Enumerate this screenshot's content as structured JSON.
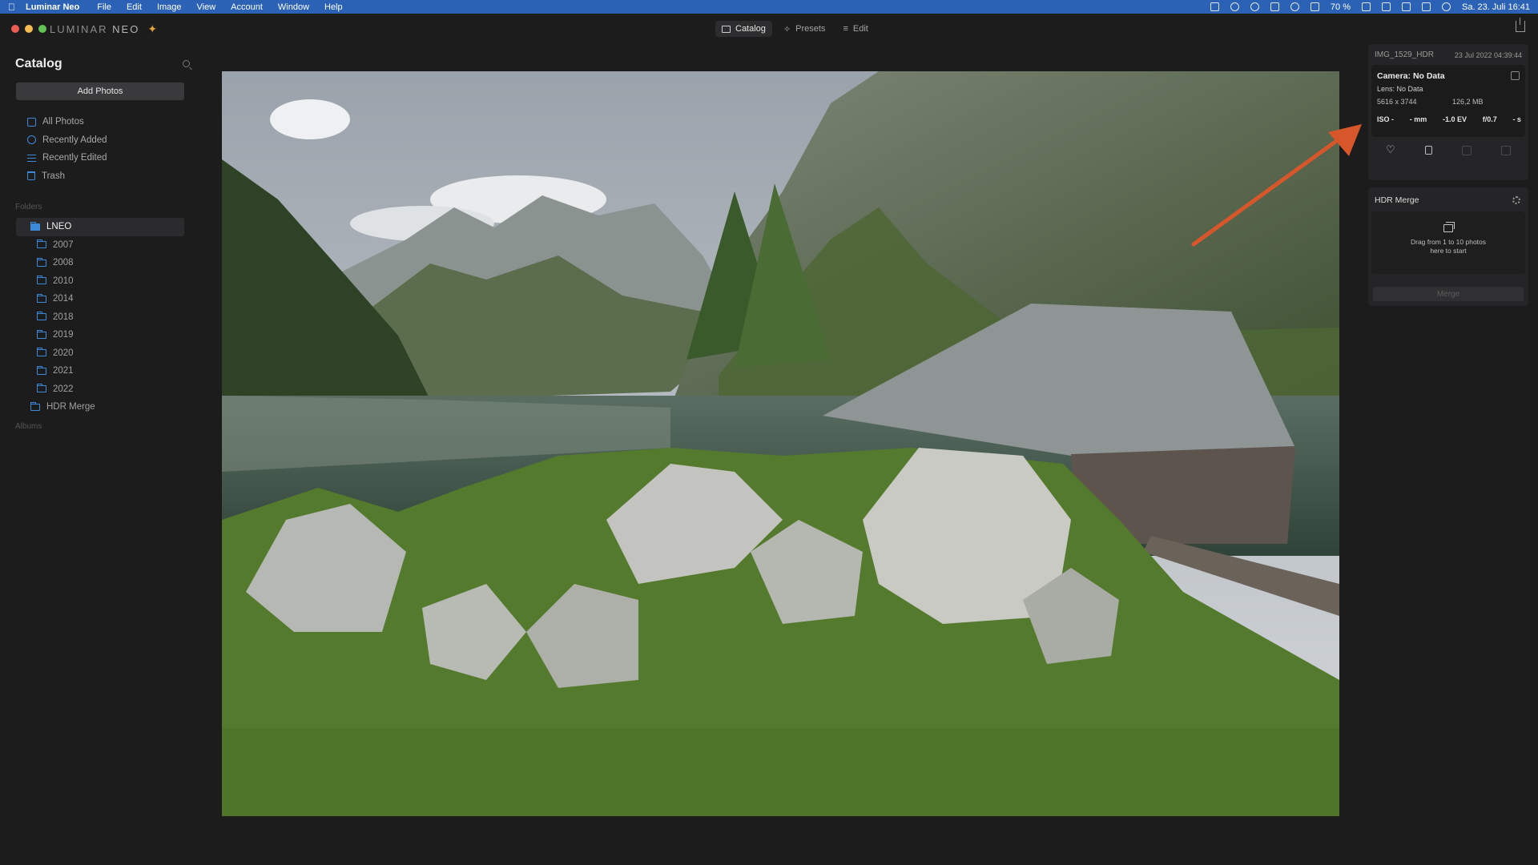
{
  "menubar": {
    "app_name": "Luminar Neo",
    "items": [
      "File",
      "Edit",
      "Image",
      "View",
      "Account",
      "Window",
      "Help"
    ],
    "battery": "70 %",
    "datetime": "Sa. 23. Juli  16:41"
  },
  "window": {
    "brand": "LUMINAR",
    "brand_suffix": "NEO",
    "tabs": [
      {
        "label": "Catalog",
        "icon": "folder-icon",
        "active": true
      },
      {
        "label": "Presets",
        "icon": "wand-icon",
        "active": false
      },
      {
        "label": "Edit",
        "icon": "sliders-icon",
        "active": false
      }
    ]
  },
  "sidebar": {
    "title": "Catalog",
    "add_photos_label": "Add Photos",
    "nav": [
      {
        "label": "All Photos",
        "icon": "photos-icon"
      },
      {
        "label": "Recently Added",
        "icon": "recently-added-icon"
      },
      {
        "label": "Recently Edited",
        "icon": "recently-edited-icon"
      },
      {
        "label": "Trash",
        "icon": "trash-icon"
      }
    ],
    "folders_label": "Folders",
    "folders": [
      {
        "label": "LNEO",
        "active": true,
        "level": 0
      },
      {
        "label": "2007",
        "level": 1
      },
      {
        "label": "2008",
        "level": 1
      },
      {
        "label": "2010",
        "level": 1
      },
      {
        "label": "2014",
        "level": 1
      },
      {
        "label": "2018",
        "level": 1
      },
      {
        "label": "2019",
        "level": 1
      },
      {
        "label": "2020",
        "level": 1
      },
      {
        "label": "2021",
        "level": 1
      },
      {
        "label": "2022",
        "level": 1
      },
      {
        "label": "HDR Merge",
        "level": 0
      }
    ],
    "albums_label": "Albums"
  },
  "info": {
    "filename": "IMG_1529_HDR",
    "date": "23 Jul 2022 04:39:44",
    "camera": "Camera: No Data",
    "lens": "Lens: No Data",
    "dimensions": "5616 x 3744",
    "file_size": "126,2 MB",
    "iso": "ISO -",
    "focal": "- mm",
    "ev": "-1.0 EV",
    "aperture": "f/0.7",
    "shutter": "- s"
  },
  "hdr_merge": {
    "title": "HDR Merge",
    "hint": "Drag from 1 to 10 photos here to start",
    "merge_label": "Merge"
  },
  "colors": {
    "accent": "#3d8ad9",
    "menubar": "#2b62b5",
    "callout": "#d8572a"
  }
}
